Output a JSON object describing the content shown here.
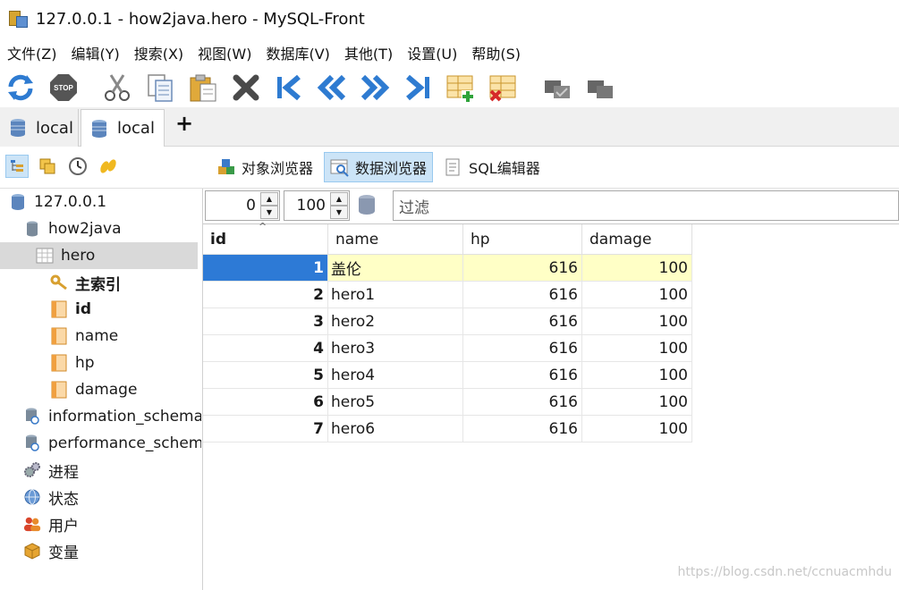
{
  "window": {
    "title": "127.0.0.1 - how2java.hero - MySQL-Front"
  },
  "menu": [
    "文件(Z)",
    "编辑(Y)",
    "搜索(X)",
    "视图(W)",
    "数据库(V)",
    "其他(T)",
    "设置(U)",
    "帮助(S)"
  ],
  "toolbar": {
    "icons": [
      "refresh-icon",
      "stop-icon",
      "cut-icon",
      "copy-icon",
      "paste-icon",
      "delete-icon",
      "first-record-icon",
      "previous-record-icon",
      "next-record-icon",
      "last-record-icon",
      "insert-record-icon",
      "delete-record-icon",
      "commit-icon",
      "rollback-icon"
    ],
    "stop_label": "STOP"
  },
  "tabs": [
    {
      "label": "local"
    },
    {
      "label": "local"
    }
  ],
  "tab_add": "+",
  "views": [
    {
      "label": "对象浏览器"
    },
    {
      "label": "数据浏览器"
    },
    {
      "label": "SQL编辑器"
    }
  ],
  "tree": [
    {
      "label": "127.0.0.1"
    },
    {
      "label": "how2java"
    },
    {
      "label": "hero"
    },
    {
      "label": "主索引"
    },
    {
      "label": "id"
    },
    {
      "label": "name"
    },
    {
      "label": "hp"
    },
    {
      "label": "damage"
    },
    {
      "label": "information_schema"
    },
    {
      "label": "performance_schema"
    },
    {
      "label": "进程"
    },
    {
      "label": "状态"
    },
    {
      "label": "用户"
    },
    {
      "label": "变量"
    }
  ],
  "filter": {
    "offset": "0",
    "limit": "100",
    "placeholder": "过滤"
  },
  "grid": {
    "columns": [
      "id",
      "name",
      "hp",
      "damage"
    ],
    "rows": [
      {
        "id": "1",
        "name": "盖伦",
        "hp": "616",
        "damage": "100"
      },
      {
        "id": "2",
        "name": "hero1",
        "hp": "616",
        "damage": "100"
      },
      {
        "id": "3",
        "name": "hero2",
        "hp": "616",
        "damage": "100"
      },
      {
        "id": "4",
        "name": "hero3",
        "hp": "616",
        "damage": "100"
      },
      {
        "id": "5",
        "name": "hero4",
        "hp": "616",
        "damage": "100"
      },
      {
        "id": "6",
        "name": "hero5",
        "hp": "616",
        "damage": "100"
      },
      {
        "id": "7",
        "name": "hero6",
        "hp": "616",
        "damage": "100"
      }
    ]
  },
  "watermark": "https://blog.csdn.net/ccnuacmhdu",
  "colors": {
    "selected_row": "#ffffc6",
    "selected_id": "#2d7ad6",
    "active_view": "#cce4f7"
  }
}
